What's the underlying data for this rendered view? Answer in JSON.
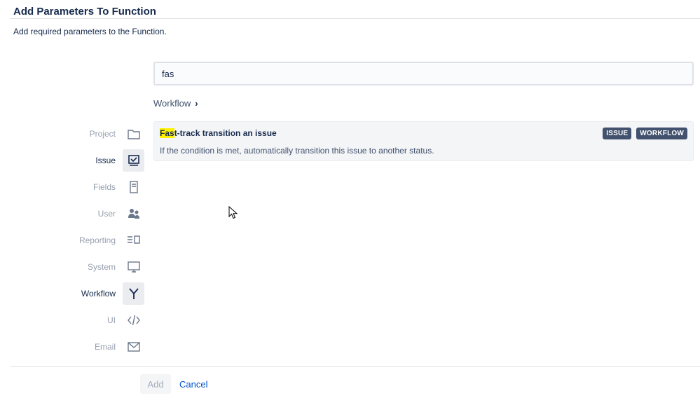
{
  "dialog": {
    "title": "Add Parameters To Function",
    "subtitle": "Add required parameters to the Function."
  },
  "search": {
    "value": "fas",
    "placeholder": ""
  },
  "breadcrumb": {
    "label": "Workflow",
    "chevron_icon": "chevron-right-icon"
  },
  "categories": [
    {
      "label": "Project",
      "icon": "folder-icon",
      "active": false
    },
    {
      "label": "Issue",
      "icon": "issue-screen-icon",
      "active": true
    },
    {
      "label": "Fields",
      "icon": "document-icon",
      "active": false
    },
    {
      "label": "User",
      "icon": "users-icon",
      "active": false
    },
    {
      "label": "Reporting",
      "icon": "report-list-icon",
      "active": false
    },
    {
      "label": "System",
      "icon": "monitor-icon",
      "active": false
    },
    {
      "label": "Workflow",
      "icon": "branch-icon",
      "active": true
    },
    {
      "label": "UI",
      "icon": "code-icon",
      "active": false
    },
    {
      "label": "Email",
      "icon": "envelope-icon",
      "active": false
    }
  ],
  "result": {
    "title_highlight": "Fas",
    "title_rest": "t-track transition an issue",
    "description": "If the condition is met, automatically transition this issue to another status.",
    "tags": [
      "ISSUE",
      "WORKFLOW"
    ]
  },
  "footer": {
    "add_label": "Add",
    "cancel_label": "Cancel"
  },
  "colors": {
    "text_primary": "#172b4d",
    "text_muted": "#97a0af",
    "tag_bg": "#42526e",
    "highlight": "#fff200",
    "link": "#0052cc"
  }
}
